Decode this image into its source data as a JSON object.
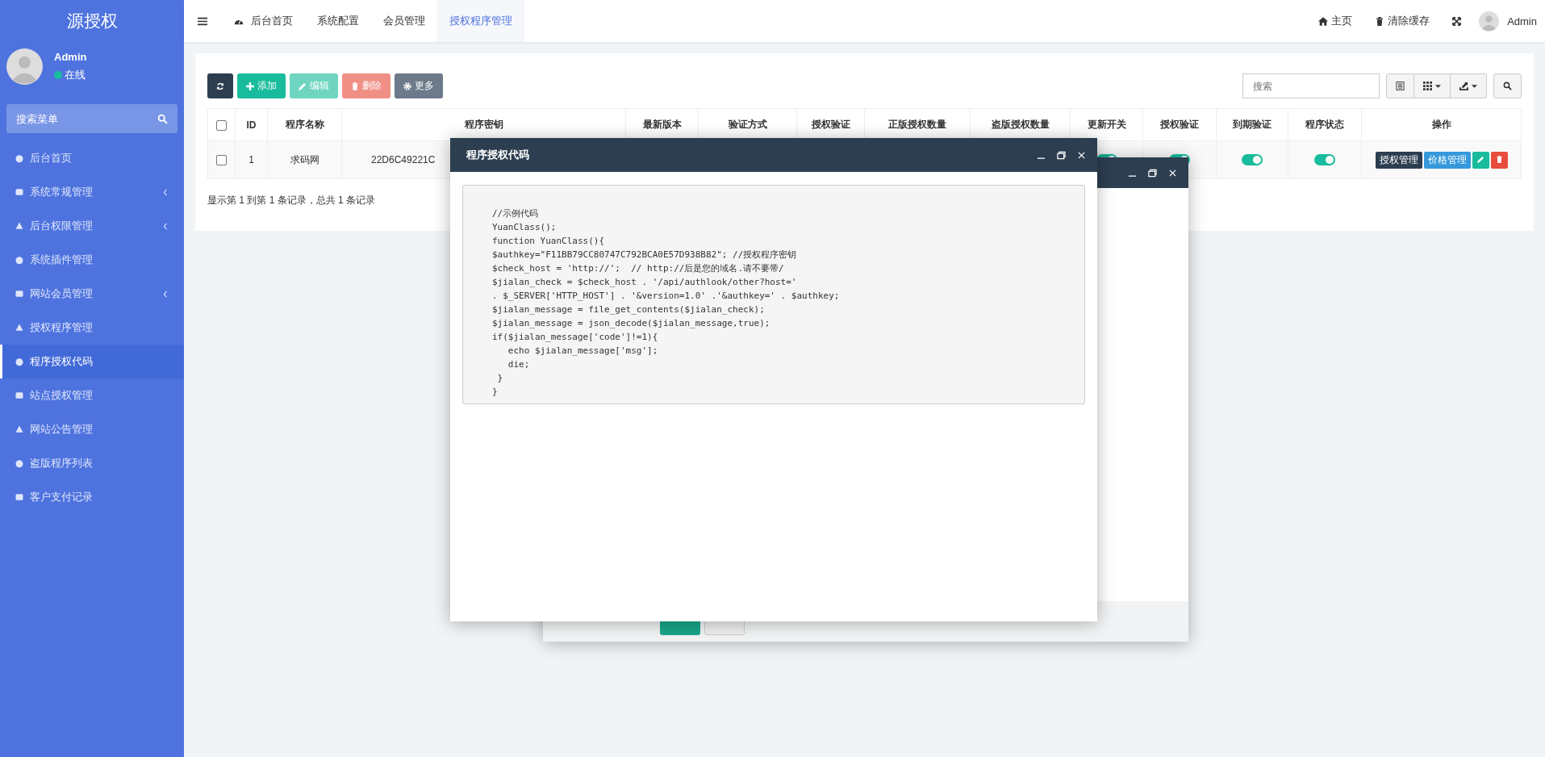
{
  "sidebar": {
    "title": "源授权",
    "user": {
      "name": "Admin",
      "status": "在线",
      "online": true
    },
    "search": {
      "placeholder": "搜索菜单"
    },
    "items": [
      {
        "label": "后台首页",
        "expandable": false,
        "selected": false
      },
      {
        "label": "系统常规管理",
        "expandable": true,
        "selected": false
      },
      {
        "label": "后台权限管理",
        "expandable": true,
        "selected": false
      },
      {
        "label": "系统插件管理",
        "expandable": false,
        "selected": false
      },
      {
        "label": "网站会员管理",
        "expandable": true,
        "selected": false
      },
      {
        "label": "授权程序管理",
        "expandable": false,
        "selected": false
      },
      {
        "label": "程序授权代码",
        "expandable": false,
        "selected": true
      },
      {
        "label": "站点授权管理",
        "expandable": false,
        "selected": false
      },
      {
        "label": "网站公告管理",
        "expandable": false,
        "selected": false
      },
      {
        "label": "盗版程序列表",
        "expandable": false,
        "selected": false
      },
      {
        "label": "客户支付记录",
        "expandable": false,
        "selected": false
      }
    ]
  },
  "topnav": {
    "tabs": [
      {
        "label": "后台首页",
        "selected": false
      },
      {
        "label": "系统配置",
        "selected": false
      },
      {
        "label": "会员管理",
        "selected": false
      },
      {
        "label": "授权程序管理",
        "selected": true
      }
    ],
    "links": [
      {
        "kind": "home",
        "label": "主页"
      },
      {
        "kind": "clear",
        "label": "清除缓存"
      }
    ],
    "user": "Admin"
  },
  "toolbar": {
    "buttons": [
      {
        "kind": "refresh",
        "disabled": false
      },
      {
        "kind": "add",
        "label": "添加",
        "disabled": false
      },
      {
        "kind": "edit",
        "label": "编辑",
        "disabled": true
      },
      {
        "kind": "delete",
        "label": "删除",
        "disabled": true
      },
      {
        "kind": "more",
        "label": "更多",
        "disabled": false
      }
    ],
    "search": {
      "placeholder": "搜索"
    }
  },
  "table": {
    "header_checked": false,
    "columns": [
      "ID",
      "程序名称",
      "程序密钥",
      "最新版本",
      "验证方式",
      "授权验证",
      "正版授权数量",
      "盗版授权数量",
      "更新开关",
      "授权验证",
      "到期验证",
      "程序状态",
      "操作"
    ],
    "rows": [
      {
        "checked": false,
        "id": "1",
        "name": "求码网",
        "key": "22D6C49221C",
        "update_switch": true,
        "auth_verify": true,
        "expiry_verify": true,
        "status": true,
        "actions": [
          "授权管理",
          "价格管理"
        ]
      }
    ]
  },
  "pagination": "显示第 1 到第 1 条记录，总共 1 条记录",
  "back_dialog": {
    "buttons": [
      {
        "kind": "primary"
      },
      {
        "kind": "default"
      }
    ]
  },
  "dialog": {
    "title": "程序授权代码",
    "code": [
      "//示例代码",
      "YuanClass();",
      "function YuanClass(){",
      "$authkey=\"F11BB79CC80747C792BCA0E57D938B82\"; //授权程序密钥",
      "$check_host = 'http://';  // http://后是您的域名.请不要带/",
      "$jialan_check = $check_host . '/api/authlook/other?host='",
      ". $_SERVER['HTTP_HOST'] . '&version=1.0' .'&authkey=' . $authkey;",
      "$jialan_message = file_get_contents($jialan_check);",
      "$jialan_message = json_decode($jialan_message,true);",
      "if($jialan_message['code']!=1){",
      "   echo $jialan_message['msg'];",
      "   die;",
      " }",
      "}"
    ]
  }
}
